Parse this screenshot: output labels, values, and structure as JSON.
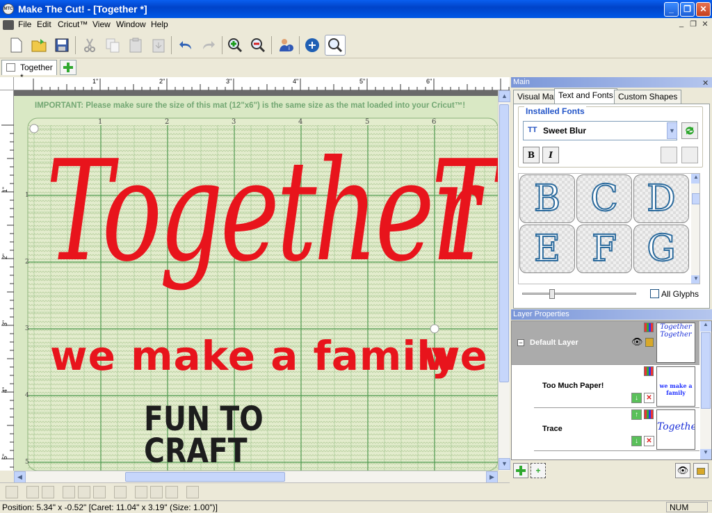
{
  "window": {
    "title": "Make The Cut! - [Together *]",
    "app_icon_label": "MTC"
  },
  "menu": [
    "File",
    "Edit",
    "Cricut™",
    "View",
    "Window",
    "Help"
  ],
  "toolbar": {
    "icons": [
      "new-document-icon",
      "open-folder-icon",
      "save-icon",
      "cut-icon",
      "copy-icon",
      "paste-icon",
      "paste-in-place-icon",
      "undo-icon",
      "redo-icon",
      "zoom-in-icon",
      "zoom-out-icon",
      "user-help-icon",
      "cricut-cut-icon",
      "zoom-tool-icon"
    ]
  },
  "tabs": {
    "doc_label": "Together *"
  },
  "ruler": {
    "h_marks": [
      "1\"",
      "2\"",
      "3\"",
      "4\"",
      "5\"",
      "6\""
    ],
    "v_marks": [
      "1\"",
      "2\"",
      "3\"",
      "4\"",
      "5\""
    ]
  },
  "mat": {
    "notice": "IMPORTANT: Please make sure the size of this mat (12\"x6\") is the same size as the mat loaded into your Cricut™!",
    "col_marks": [
      "1",
      "2",
      "3",
      "4",
      "5",
      "6"
    ],
    "row_marks": [
      "1",
      "2",
      "3",
      "4",
      "5"
    ],
    "colors": {
      "mat_bg": "#d9e8c4",
      "grid": "#4f9a4f",
      "text": "#e8141c"
    }
  },
  "canvas_text": {
    "script_title": "Together",
    "script_title_partial": "T",
    "subtitle": "we make a family",
    "subtitle_partial": "we",
    "logo_line1": "FUN TO",
    "logo_line2": "CRAFT"
  },
  "right_panel": {
    "main_title": "Main",
    "tabs": [
      "Visual Mat",
      "Text and Fonts",
      "Custom Shapes"
    ],
    "selected_tab": "Text and Fonts",
    "installed_fonts_label": "Installed Fonts",
    "font_name": "Sweet Blur",
    "bold_label": "B",
    "italic_label": "I",
    "glyphs": [
      "B",
      "C",
      "D",
      "E",
      "F",
      "G"
    ],
    "all_glyphs_label": "All Glyphs"
  },
  "layers": {
    "title": "Layer Properties",
    "items": [
      {
        "name": "Default Layer",
        "thumb": "Together Together"
      },
      {
        "name": "Too Much Paper!",
        "thumb": "we make a family"
      },
      {
        "name": "Trace",
        "thumb": "Together"
      }
    ]
  },
  "status": {
    "text": "Position: 5.34\" x -0.52\" [Caret: 11.04\" x 3.19\" (Size: 1.00\")]",
    "num": "NUM"
  }
}
